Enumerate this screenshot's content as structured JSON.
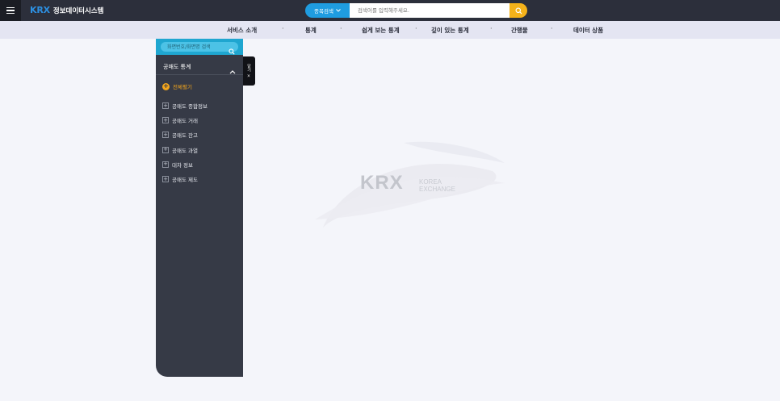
{
  "header": {
    "logo_mark": "KRX",
    "logo_text": "정보데이터시스템",
    "search": {
      "category": "종목검색",
      "placeholder": "검색어를 입력해주세요."
    }
  },
  "nav": {
    "items": [
      "서비스 소개",
      "통계",
      "쉽게 보는 통계",
      "깊이 있는 통계",
      "간행물",
      "데이터 상품"
    ],
    "separator": "·"
  },
  "sidebar": {
    "search_placeholder": "화면번호/화면명 검색",
    "title": "공매도 통계",
    "expand_all": "전체펼기",
    "items": [
      "공매도 종합정보",
      "공매도 거래",
      "공매도 잔고",
      "공매도 과열",
      "대차 정보",
      "공매도 제도"
    ],
    "close_label": "닫기 ×"
  },
  "watermark": {
    "mark": "KRX",
    "line1": "KOREA",
    "line2": "EXCHANGE"
  },
  "colors": {
    "topbar": "#2c2f3b",
    "accent_blue": "#1f9ce0",
    "accent_orange": "#f5b21a",
    "sidebar": "#363a46"
  },
  "icons": [
    "hamburger-menu-icon",
    "search-icon",
    "chevron-down-icon",
    "chevron-up-icon",
    "plus-icon"
  ]
}
